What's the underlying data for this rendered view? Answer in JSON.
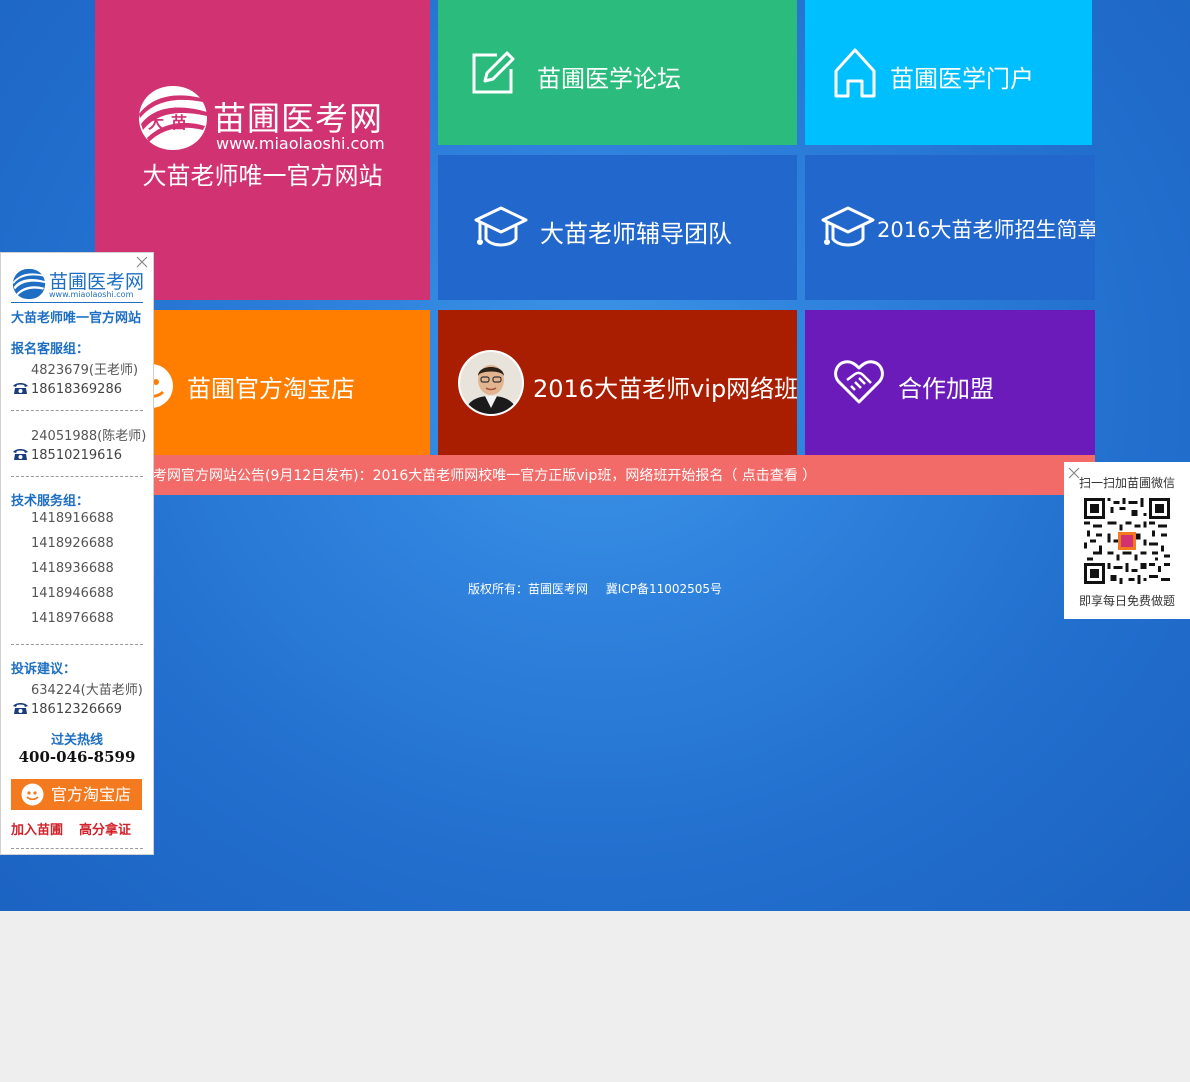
{
  "logo_tile": {
    "brand_name": "苗圃医考网",
    "brand_url": "www.miaolaoshi.com",
    "logo_badge": "大苗",
    "slogan": "大苗老师唯一官方网站"
  },
  "tiles": {
    "forum": "苗圃医学论坛",
    "portal": "苗圃医学门户",
    "team": "大苗老师辅导团队",
    "admission": "2016大苗老师招生简章",
    "taobao": "苗圃官方淘宝店",
    "vip": "2016大苗老师vip网络班",
    "join": "合作加盟"
  },
  "notice": "考网官方网站公告(9月12日发布)：2016大苗老师网校唯一官方正版vip班，网络班开始报名（ 点击查看 ）",
  "footer": {
    "copyright": "版权所有：苗圃医考网",
    "icp": "冀ICP备11002505号"
  },
  "left_panel": {
    "brand_name": "苗圃医考网",
    "brand_url": "www.miaolaoshi.com",
    "slogan": "大苗老师唯一官方网站",
    "signup_title": "报名客服组：",
    "signup_qq1": "4823679(王老师)",
    "signup_phone1": "18618369286",
    "signup_qq2": "24051988(陈老师)",
    "signup_phone2": "18510219616",
    "tech_title": "技术服务组：",
    "tech_numbers": [
      "1418916688",
      "1418926688",
      "1418936688",
      "1418946688",
      "1418976688"
    ],
    "complaint_title": "投诉建议：",
    "complaint_qq": "634224(大苗老师)",
    "complaint_phone": "18612326669",
    "hotline_title": "过关热线",
    "hotline": "400-046-8599",
    "taobao_button": "官方淘宝店",
    "join_link": "加入苗圃",
    "score_link": "高分拿证"
  },
  "right_panel": {
    "title": "扫一扫加苗圃微信",
    "subtitle": "即享每日免费做题"
  },
  "colors": {
    "logo_tile": "#d13272",
    "forum_tile": "#2bbb7c",
    "portal_tile": "#00bfff",
    "team_tile": "#2167cc",
    "taobao_tile": "#ff7e00",
    "vip_tile": "#a91e00",
    "join_tile": "#6b1bb9",
    "notice_bar": "#f26b69",
    "panel_blue": "#1e6fc3",
    "panel_red": "#d0232b"
  },
  "icons": {
    "forum": "edit-icon",
    "portal": "home-icon",
    "team": "graduation-cap-icon",
    "admission": "graduation-cap-icon",
    "taobao": "taobao-icon",
    "vip": "teacher-avatar",
    "join": "handshake-heart-icon",
    "phone": "phone-icon",
    "close": "close-icon",
    "qr": "qr-code"
  }
}
